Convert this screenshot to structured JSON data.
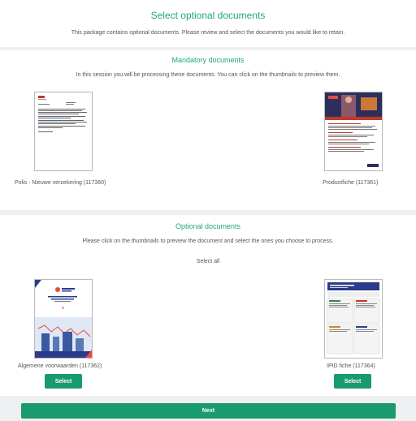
{
  "header": {
    "title": "Select optional documents",
    "subtitle": "This package contains optional documents. Please review and select the documents you would like to retain."
  },
  "mandatory": {
    "title": "Mandatory documents",
    "description": "In this session you will be processing these documents. You can click on the thumbnails to preview them.",
    "documents": [
      {
        "caption": "Polis - Nieuwe verzekering (117360)"
      },
      {
        "caption": "Productfiche (117361)"
      }
    ]
  },
  "optional": {
    "title": "Optional documents",
    "description": "Please click on the thumbnails to preview the document and select the ones you choose to process.",
    "select_all": "Select all",
    "documents": [
      {
        "caption": "Algemene voorwaarden (117362)",
        "select_label": "Select"
      },
      {
        "caption": "IPID fiche (117364)",
        "select_label": "Select"
      }
    ]
  },
  "footer": {
    "next_label": "Next"
  },
  "colors": {
    "accent": "#1fa67a",
    "button": "#1a9b6d",
    "background": "#eef0f1"
  }
}
